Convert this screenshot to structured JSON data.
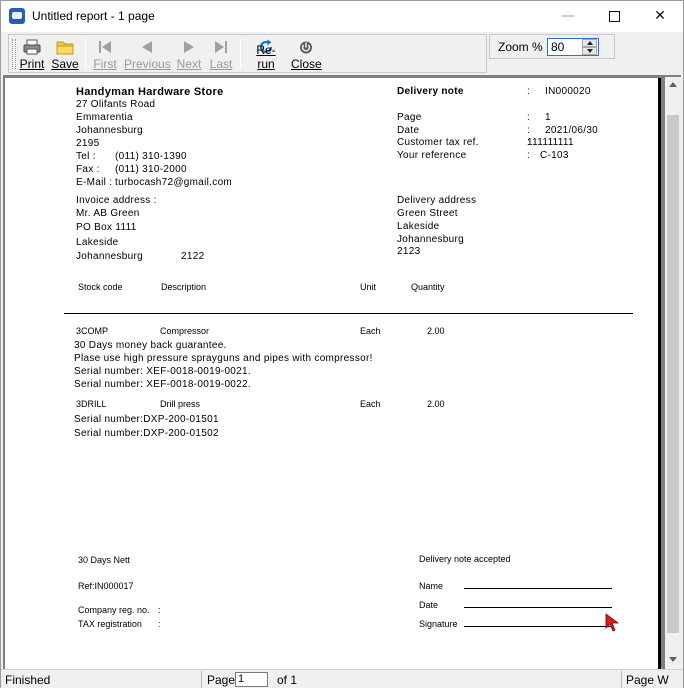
{
  "window": {
    "title": "Untitled report - 1 page",
    "minimize_glyph": "—",
    "close_glyph": "✕"
  },
  "toolbar": {
    "print": "Print",
    "save": "Save",
    "first": "First",
    "previous": "Previous",
    "next": "Next",
    "last": "Last",
    "rerun": "Re-run",
    "close": "Close",
    "zoom_label": "Zoom % :",
    "zoom_value": "80"
  },
  "report": {
    "company": {
      "name": "Handyman Hardware Store",
      "address1": "27 Olifants Road",
      "address2": "Emmarentia",
      "city": "Johannesburg",
      "postcode": "2195",
      "tel_label": "Tel :",
      "tel": "(011) 310-1390",
      "fax_label": "Fax :",
      "fax": "(011) 310-2000",
      "email_label": "E-Mail :",
      "email": "turbocash72@gmail.com"
    },
    "header": {
      "doc_type_label": "Delivery note",
      "doc_number": "IN000020",
      "page_label": "Page",
      "page_value": "1",
      "date_label": "Date",
      "date_value": "2021/06/30",
      "tax_label": "Customer tax ref.",
      "tax_value": "111111111",
      "ref_label": "Your reference",
      "ref_value": "C-103",
      "colon": ":"
    },
    "invoice_address": {
      "label": "Invoice address :",
      "line1": "Mr. AB Green",
      "line2": "PO Box 1111",
      "line3": "Lakeside",
      "line4": "Johannesburg",
      "postcode": "2122"
    },
    "delivery_address": {
      "label": "Delivery address",
      "line1": "Green Street",
      "line2": "Lakeside",
      "line3": "Johannesburg",
      "postcode": "2123"
    },
    "columns": {
      "stock_code": "Stock code",
      "description": "Description",
      "unit": "Unit",
      "quantity": "Quantity"
    },
    "items": [
      {
        "code": "3COMP",
        "description": "Compressor",
        "unit": "Each",
        "quantity": "2.00",
        "notes": [
          "30 Days money back guarantee.",
          "Plase use high pressure sprayguns and pipes with compressor!",
          "Serial number: XEF-0018-0019-0021.",
          "Serial number: XEF-0018-0019-0022."
        ]
      },
      {
        "code": "3DRILL",
        "description": "Drill press",
        "unit": "Each",
        "quantity": "2.00",
        "notes": [
          "Serial number:DXP-200-01501",
          "Serial number:DXP-200-01502"
        ]
      }
    ],
    "footer": {
      "terms": "30 Days Nett",
      "ref": "Ref:IN000017",
      "company_reg_label": "Company reg. no.",
      "tax_reg_label": "TAX registration",
      "colon": ":",
      "accepted": "Delivery note accepted",
      "name_label": "Name",
      "date_label": "Date",
      "signature_label": "Signature"
    }
  },
  "status": {
    "state": "Finished",
    "page_label": "Page",
    "page_value": "1",
    "of_label": "of 1",
    "page_width": "Page W"
  }
}
